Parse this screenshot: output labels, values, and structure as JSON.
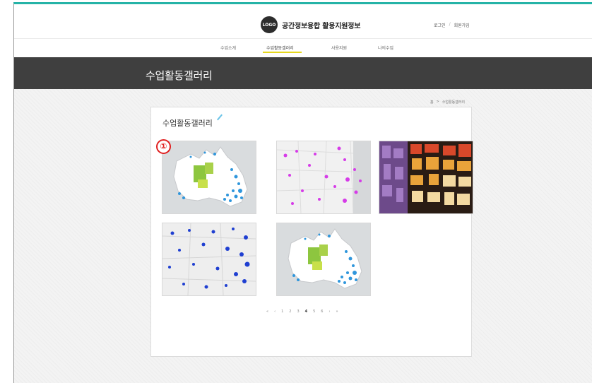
{
  "header": {
    "logo_text": "LOGO",
    "site_title": "공간정보융합 활용지원정보",
    "login": "로그인",
    "signup": "회원가입"
  },
  "nav": {
    "items": [
      {
        "label": "수업소개"
      },
      {
        "label": "수업활동갤러리"
      },
      {
        "label": "사용지원"
      },
      {
        "label": "나의수업"
      }
    ],
    "active_index": 1
  },
  "banner": {
    "title": "수업활동갤러리"
  },
  "breadcrumb": {
    "home": "홈",
    "separator": ">",
    "current": "수업활동갤러리"
  },
  "gallery": {
    "title": "수업활동갤러리",
    "marker": "①",
    "thumbnails": [
      {
        "name": "map-australia-blue-green"
      },
      {
        "name": "map-australia-magenta"
      },
      {
        "name": "map-city-blocks"
      },
      {
        "name": "map-australia-blue-dots"
      },
      {
        "name": "map-australia-blue-green-2"
      }
    ]
  },
  "pagination": {
    "first": "«",
    "prev": "‹",
    "pages": [
      "1",
      "2",
      "3",
      "4",
      "5",
      "6"
    ],
    "current": "4",
    "next": "›",
    "last": "»"
  },
  "colors": {
    "accent_top_border": "#25b3a7",
    "banner_bg": "#3f3f3f",
    "nav_active_underline": "#e6d81e",
    "marker_red": "#e02020"
  }
}
